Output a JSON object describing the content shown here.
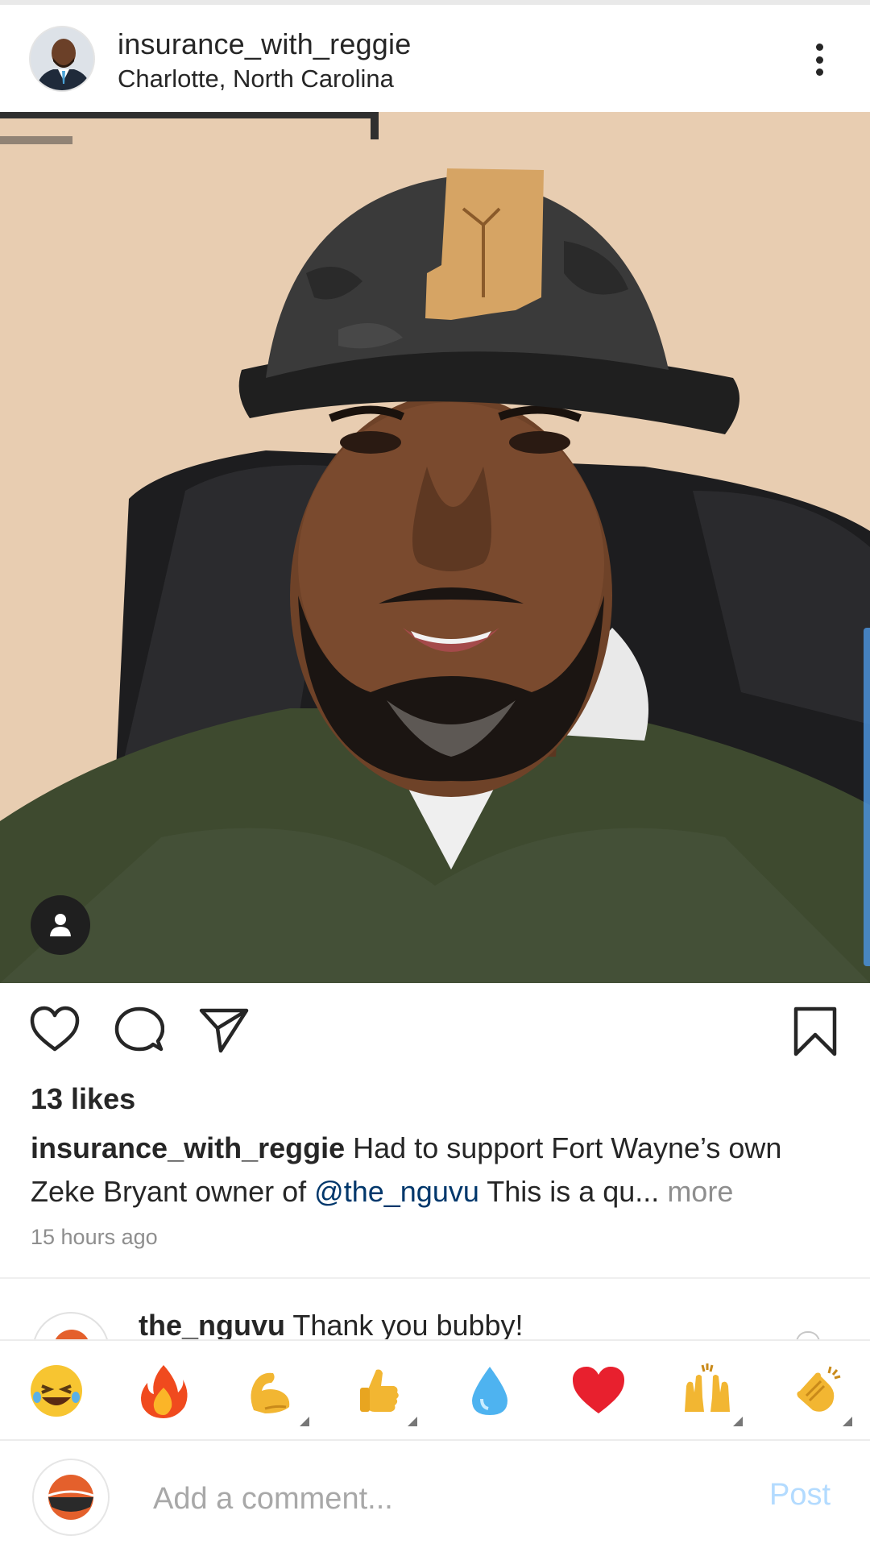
{
  "post": {
    "username": "insurance_with_reggie",
    "location": "Charlotte, North Carolina",
    "photo_alt": "Photo",
    "likes": "13 likes",
    "caption": {
      "username": "insurance_with_reggie",
      "text_before": " Had to support Fort Wayne’s own Zeke Bryant owner of ",
      "mention": "@the_nguvu",
      "text_after": " This is a qu...",
      "more": " more"
    },
    "timestamp": "15 hours ago"
  },
  "comment_preview": {
    "username": "the_nguvu",
    "text": " Thank you bubby!"
  },
  "emoji_bar": {
    "items": [
      "laughing",
      "fire",
      "flexed-biceps",
      "thumbs-up",
      "droplet",
      "red-heart",
      "raising-hands",
      "clapping-hands"
    ]
  },
  "composer": {
    "placeholder": "Add a comment...",
    "post_label": "Post"
  },
  "colors": {
    "mention": "#00376b",
    "muted": "#8e8e8e",
    "post_disabled": "#b3dbff"
  }
}
